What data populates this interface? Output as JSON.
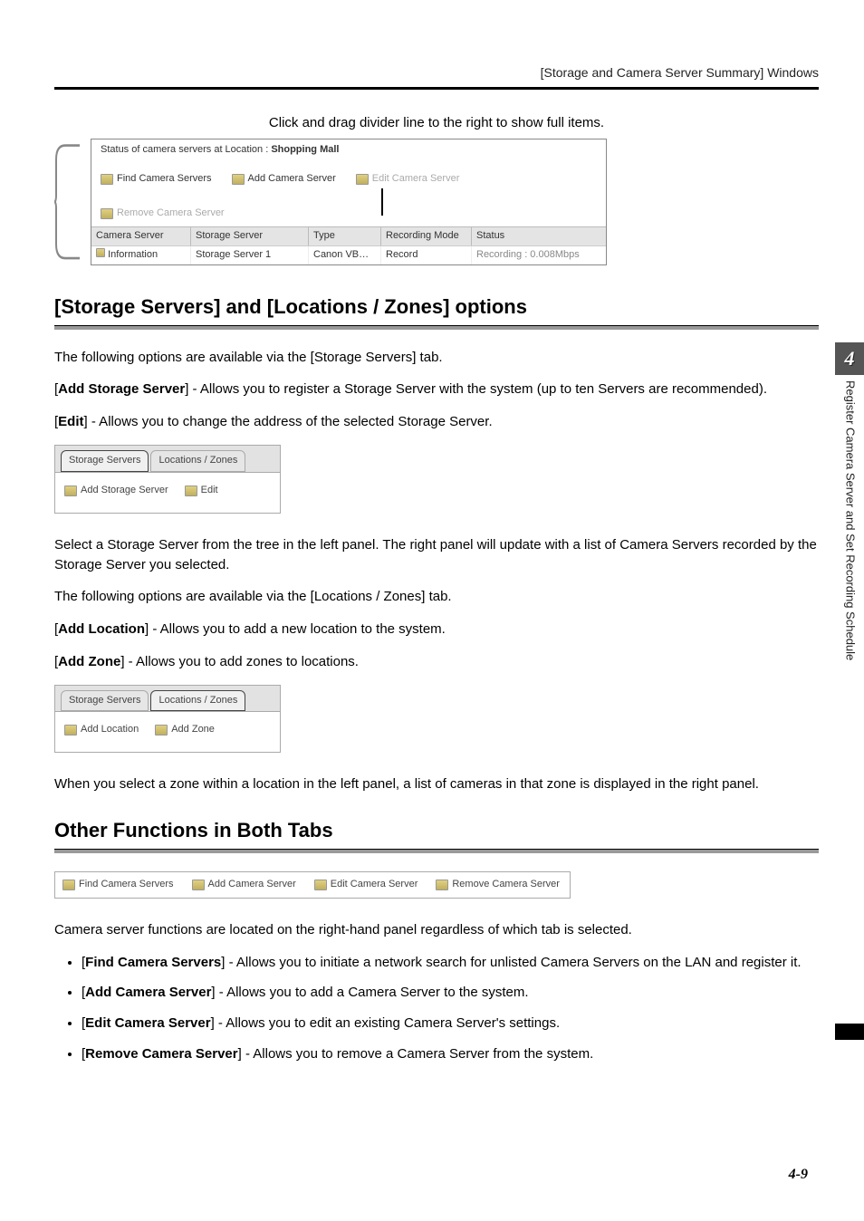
{
  "header": {
    "section_title": "[Storage and Camera Server Summary] Windows"
  },
  "fig1": {
    "caption": "Click and drag divider line to the right to show full items.",
    "status_line_prefix": "Status of camera servers at Location : ",
    "status_location": "Shopping Mall",
    "toolbar": {
      "find": "Find Camera Servers",
      "add": "Add Camera Server",
      "edit": "Edit Camera Server",
      "remove": "Remove Camera Server"
    },
    "columns": {
      "c1": "Camera Server",
      "c2": "Storage Server",
      "c3": "Type",
      "c4": "Recording Mode",
      "c5": "Status"
    },
    "row": {
      "c1": "Information",
      "c2": "Storage Server 1",
      "c3": "Canon VB…",
      "c4": "Record",
      "c5": "Recording : 0.008Mbps"
    }
  },
  "section1": {
    "title": "[Storage Servers] and [Locations / Zones] options",
    "p_intro": "The following options are available via the [Storage Servers] tab.",
    "add_storage_label": "Add Storage Server",
    "add_storage_desc": "] - Allows you to register a Storage Server with the system (up to ten Servers are recommended).",
    "edit_label": "Edit",
    "edit_desc": "] - Allows you to change the address of the selected Storage Server.",
    "fig2": {
      "tab_active": "Storage Servers",
      "tab_inactive": "Locations / Zones",
      "btn_add": "Add Storage Server",
      "btn_edit": "Edit"
    },
    "p_select": "Select a Storage Server from the tree in the left panel. The right panel will update with a list of Camera Servers recorded by the Storage Server you selected.",
    "p_loc_intro": "The following options are available via the [Locations / Zones] tab.",
    "add_location_label": "Add Location",
    "add_location_desc": "] - Allows you to add a new location to the system.",
    "add_zone_label": "Add Zone",
    "add_zone_desc": "] - Allows you to add zones to locations.",
    "fig3": {
      "tab_inactive": "Storage Servers",
      "tab_active": "Locations / Zones",
      "btn_add_location": "Add Location",
      "btn_add_zone": "Add Zone"
    },
    "p_zone_select": "When you select a zone within a location in the left panel, a list of cameras in that zone is displayed in the right panel."
  },
  "section2": {
    "title": "Other Functions in Both Tabs",
    "fig4": {
      "find": "Find Camera Servers",
      "add": "Add Camera Server",
      "edit": "Edit Camera Server",
      "remove": "Remove Camera Server"
    },
    "p_intro": "Camera server functions are located on the right-hand panel regardless of which tab is selected.",
    "items": {
      "find_label": "Find Camera Servers",
      "find_desc": "] - Allows you to initiate a network search for unlisted Camera Servers on the LAN and register it.",
      "add_label": "Add Camera Server",
      "add_desc": "] - Allows you to add a Camera Server to the system.",
      "edit_label": "Edit Camera Server",
      "edit_desc": "] - Allows you to edit an existing Camera Server's settings.",
      "remove_label": "Remove Camera Server",
      "remove_desc": "] - Allows you to remove a Camera Server from the system."
    }
  },
  "side": {
    "chapter": "4",
    "label": "Register Camera Server and Set Recording Schedule"
  },
  "footer": {
    "page": "4-9"
  }
}
